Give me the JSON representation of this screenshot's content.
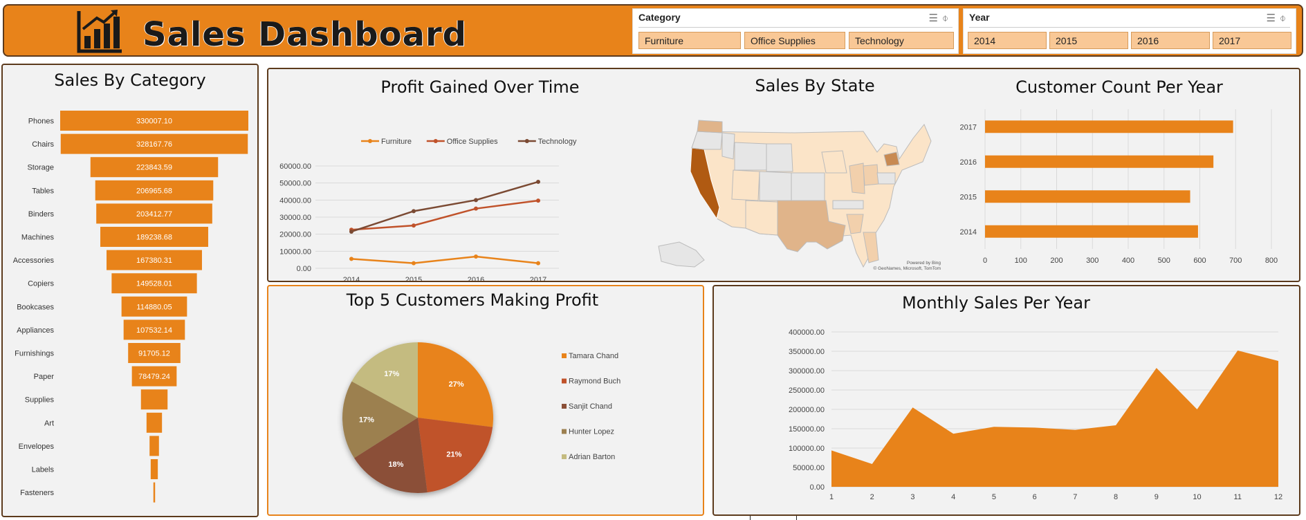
{
  "header": {
    "title": "Sales Dashboard",
    "icon": "bar-chart-growth-icon",
    "accent": "#e8831a",
    "border": "#5c3a1c"
  },
  "slicers": [
    {
      "title": "Category",
      "options": [
        "Furniture",
        "Office Supplies",
        "Technology"
      ]
    },
    {
      "title": "Year",
      "options": [
        "2014",
        "2015",
        "2016",
        "2017"
      ]
    }
  ],
  "map": {
    "title": "Sales By State",
    "credits": [
      "Powered by Bing",
      "© GeoNames, Microsoft, TomTom"
    ]
  },
  "chart_data": [
    {
      "id": "sales-by-category",
      "type": "bar",
      "orientation": "horizontal-funnel",
      "title": "Sales By Category",
      "categories": [
        "Phones",
        "Chairs",
        "Storage",
        "Tables",
        "Binders",
        "Machines",
        "Accessories",
        "Copiers",
        "Bookcases",
        "Appliances",
        "Furnishings",
        "Paper",
        "Supplies",
        "Art",
        "Envelopes",
        "Labels",
        "Fasteners"
      ],
      "values": [
        330007.1,
        328167.76,
        223843.59,
        206965.68,
        203412.77,
        189238.68,
        167380.31,
        149528.01,
        114880.05,
        107532.14,
        91705.12,
        78479.24,
        46673.54,
        27118.79,
        16476.4,
        12486.31,
        3024.28
      ],
      "labels": [
        "330007.10",
        "328167.76",
        "223843.59",
        "206965.68",
        "203412.77",
        "189238.68",
        "167380.31",
        "149528.01",
        "114880.05",
        "107532.14",
        "91705.12",
        "78479.24",
        "",
        "",
        "",
        "",
        ""
      ],
      "color": "#e8831a"
    },
    {
      "id": "profit-over-time",
      "type": "line",
      "title": "Profit Gained Over Time",
      "categories": [
        "2014",
        "2015",
        "2016",
        "2017"
      ],
      "series": [
        {
          "name": "Furniture",
          "values": [
            5500,
            3000,
            6900,
            3000
          ],
          "color": "#e8831a"
        },
        {
          "name": "Office Supplies",
          "values": [
            22600,
            25100,
            35000,
            39700
          ],
          "color": "#c0522a"
        },
        {
          "name": "Technology",
          "values": [
            21500,
            33500,
            40000,
            50700
          ],
          "color": "#7b4a33"
        }
      ],
      "yticks": [
        "0.00",
        "10000.00",
        "20000.00",
        "30000.00",
        "40000.00",
        "50000.00",
        "60000.00"
      ],
      "ylim": [
        0,
        60000
      ],
      "legend": "top"
    },
    {
      "id": "customer-count",
      "type": "bar",
      "orientation": "horizontal",
      "title": "Customer Count Per Year",
      "categories": [
        "2017",
        "2016",
        "2015",
        "2014"
      ],
      "values": [
        693,
        638,
        573,
        595
      ],
      "xticks": [
        "0",
        "100",
        "200",
        "300",
        "400",
        "500",
        "600",
        "700",
        "800"
      ],
      "xlim": [
        0,
        800
      ],
      "color": "#e8831a"
    },
    {
      "id": "top-customers",
      "type": "pie",
      "title": "Top 5 Customers Making Profit",
      "labels": [
        "Tamara Chand",
        "Raymond Buch",
        "Sanjit Chand",
        "Hunter Lopez",
        "Adrian Barton"
      ],
      "values": [
        27,
        21,
        18,
        17,
        17
      ],
      "value_labels": [
        "27%",
        "21%",
        "18%",
        "17%",
        "17%"
      ],
      "colors": [
        "#e8831a",
        "#c0522a",
        "#8b5038",
        "#9c8050",
        "#c4bb80"
      ],
      "legend": "right"
    },
    {
      "id": "monthly-sales",
      "type": "area",
      "title": "Monthly Sales Per Year",
      "categories": [
        "1",
        "2",
        "3",
        "4",
        "5",
        "6",
        "7",
        "8",
        "9",
        "10",
        "11",
        "12"
      ],
      "values": [
        94000,
        59000,
        205000,
        137000,
        155000,
        153000,
        147000,
        159000,
        307000,
        200000,
        352000,
        325000
      ],
      "yticks": [
        "0.00",
        "50000.00",
        "100000.00",
        "150000.00",
        "200000.00",
        "250000.00",
        "300000.00",
        "350000.00",
        "400000.00"
      ],
      "ylim": [
        0,
        400000
      ],
      "color": "#e8831a"
    }
  ]
}
